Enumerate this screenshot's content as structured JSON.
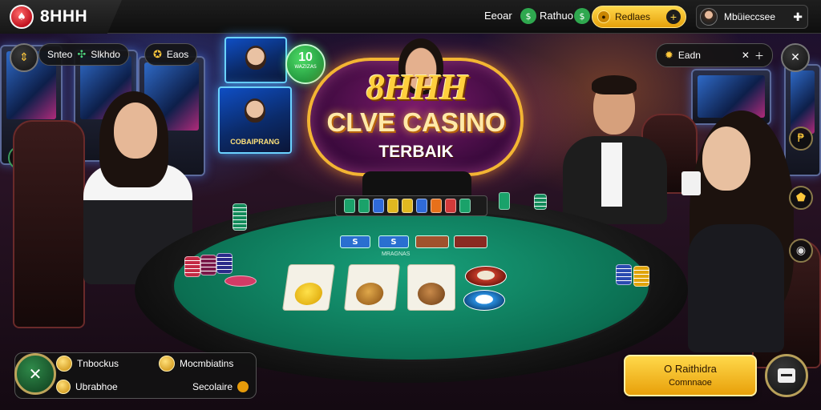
{
  "header": {
    "logo_text": "8HHH",
    "links": [
      "Eeoar",
      "Rathuo"
    ],
    "coin_pill_label": "Redlaes",
    "username": "Mbüieccsee"
  },
  "left_hud": {
    "pill_a_label": "Snteo",
    "pill_b_label": "Slkhdo",
    "pill_c_label": "Eaos"
  },
  "promo_badge": {
    "big": "10",
    "small": "WAZIZAS"
  },
  "poster_caption": "COBAIPRANG",
  "logo": {
    "top": "8HHH",
    "title": "CLVE CASINO",
    "subtitle": "TERBAIK"
  },
  "felt": {
    "tile_a": "S",
    "tile_b": "S",
    "caption": "MRAGNAS",
    "card_1_text": "",
    "card_2_text": "",
    "card_3_text": ""
  },
  "right_hud": {
    "pill_label": "Eadn"
  },
  "bottom_panel": {
    "item_1": "Tnbockus",
    "item_2": "Mocmbiatins",
    "item_3": "Ubrabhoe",
    "item_4": "Secolaire"
  },
  "cta": {
    "line1": "O Raithidra",
    "line2": "Comnnaoe"
  },
  "colors": {
    "accent_gold": "#ffd74a",
    "felt_green": "#0b6f52",
    "brand_red": "#c1121f"
  },
  "icons": {
    "logo": "casino-chip-icon",
    "top_icon_a": "dollar-icon",
    "top_icon_b": "dollar-icon",
    "left_round": "swap-icon",
    "settings": "gear-icon",
    "tools": "wrench-icon",
    "store": "store-icon"
  }
}
